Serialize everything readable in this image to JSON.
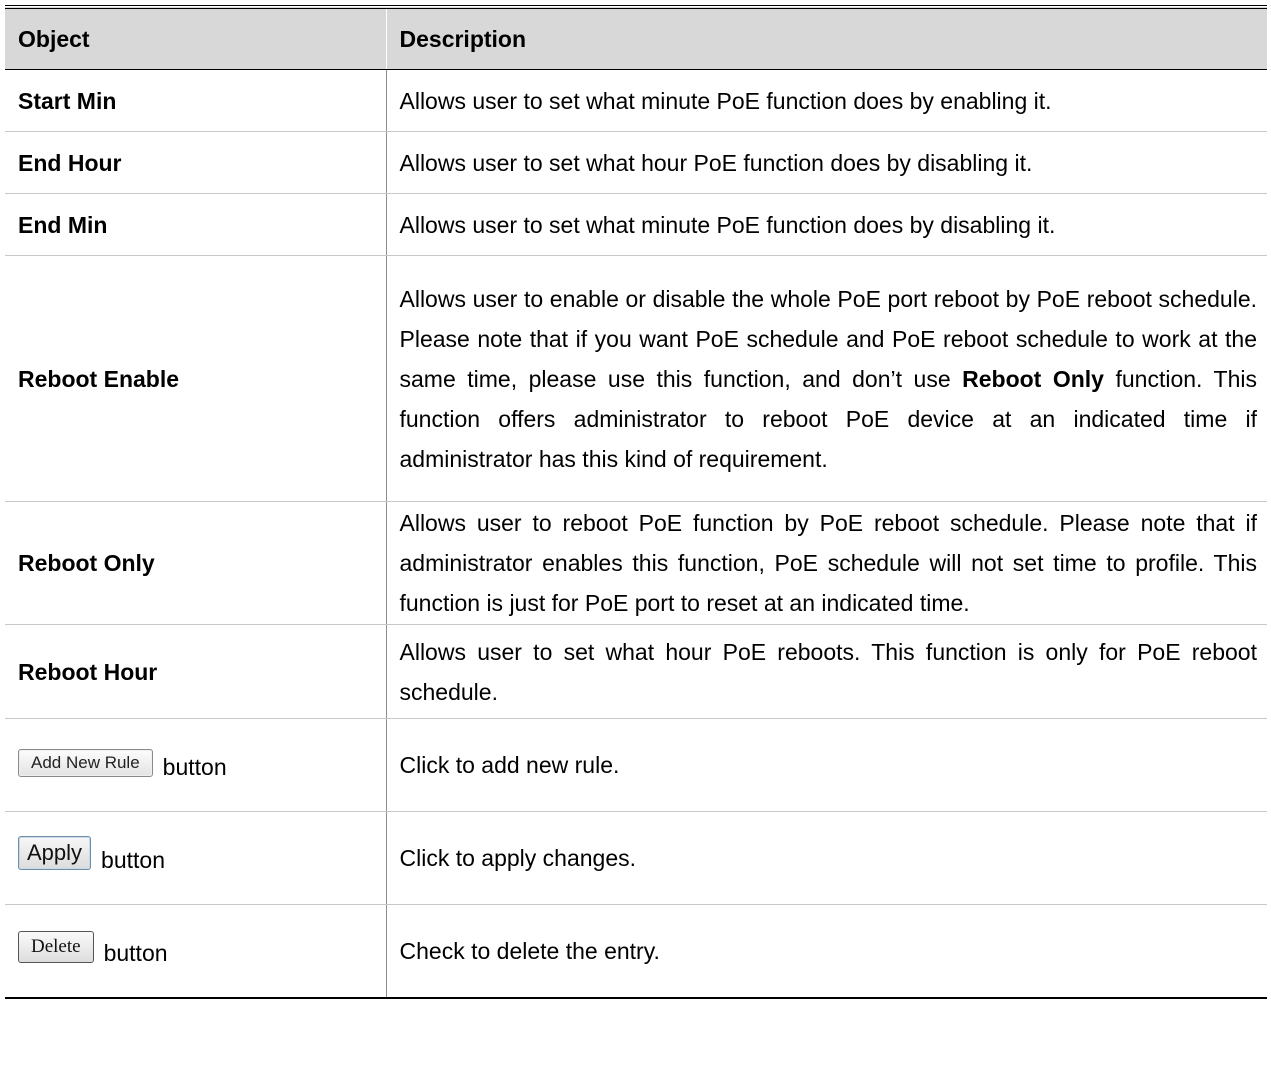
{
  "table": {
    "headers": {
      "object": "Object",
      "description": "Description"
    },
    "rows": [
      {
        "object": "Start Min",
        "description": "Allows user to set what minute PoE function does by enabling it."
      },
      {
        "object": "End Hour",
        "description": "Allows user to set what hour PoE function does by disabling it."
      },
      {
        "object": "End Min",
        "description": "Allows user to set what minute PoE function does by disabling it."
      },
      {
        "object": "Reboot Enable",
        "description_part1": "Allows user to enable or disable the whole PoE port reboot by PoE reboot schedule. Please note that if you want PoE schedule and PoE reboot schedule to work at the same time, please use this function, and don’t use ",
        "description_bold": "Reboot Only",
        "description_part2": " function. This function offers administrator to reboot PoE device at an indicated time if administrator has this kind of requirement."
      },
      {
        "object": "Reboot Only",
        "description": "Allows user to reboot PoE function by PoE reboot schedule. Please note that if administrator enables this function, PoE schedule will not set time to profile. This function is just for PoE port to reset at an indicated time."
      },
      {
        "object": "Reboot Hour",
        "description": "Allows user to set what hour PoE reboots. This function is only for PoE reboot schedule."
      },
      {
        "button_label": "Add New Rule",
        "object_suffix": "button",
        "description": "Click to add new rule."
      },
      {
        "button_label": "Apply",
        "object_suffix": "button",
        "description": "Click to apply changes."
      },
      {
        "button_label": "Delete",
        "object_suffix": "button",
        "description": "Check to delete the entry."
      }
    ]
  }
}
